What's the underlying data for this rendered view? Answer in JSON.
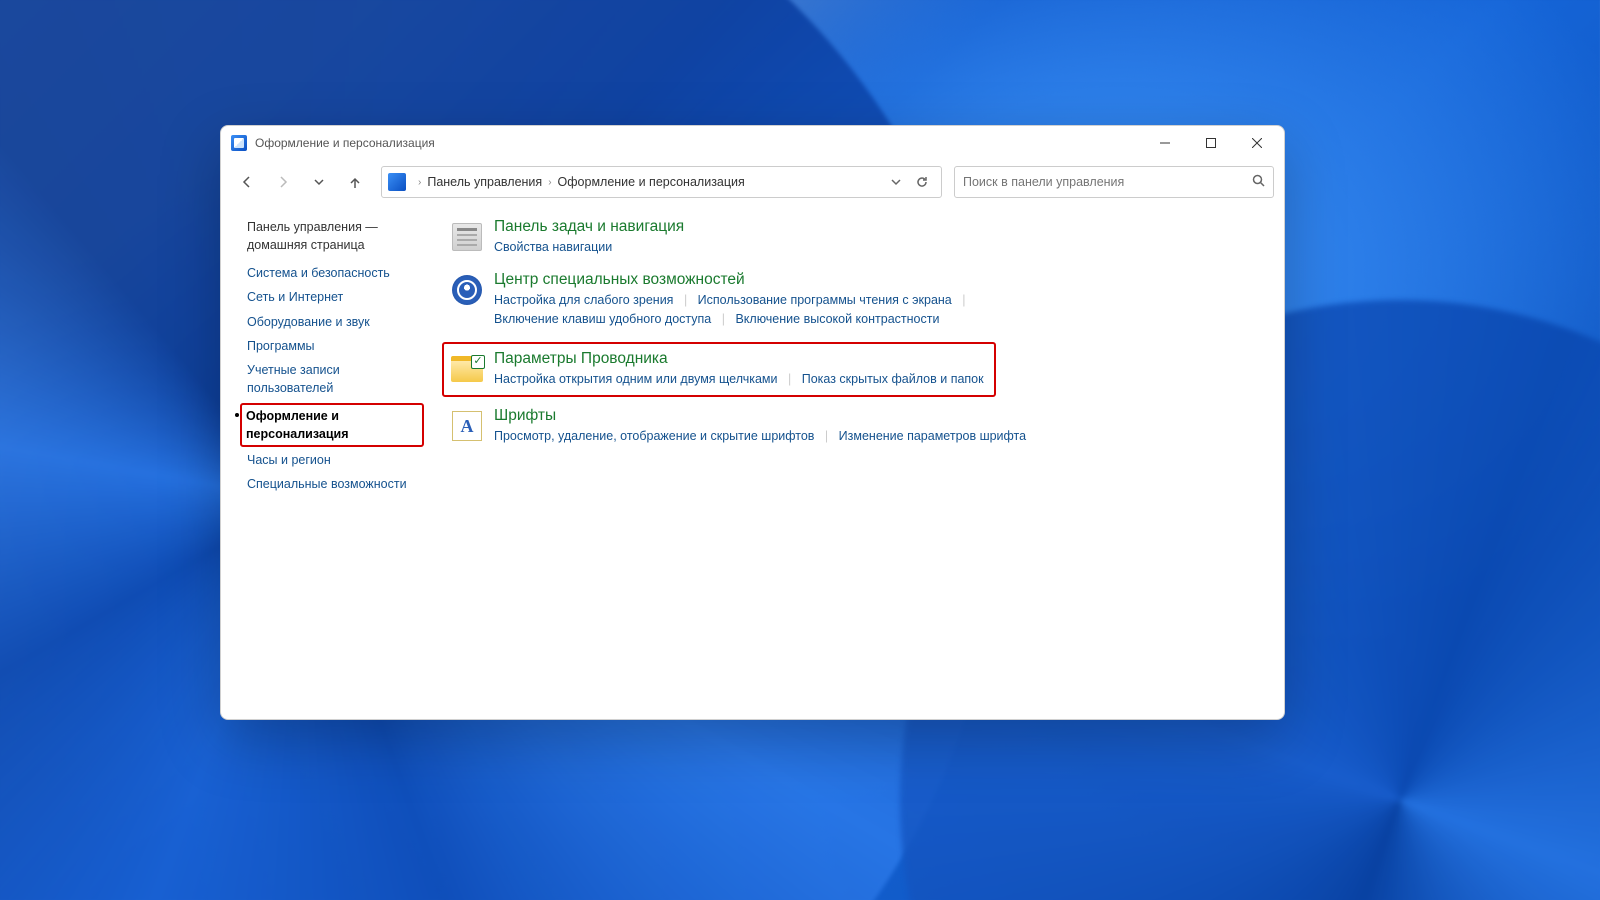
{
  "window": {
    "title": "Оформление и персонализация"
  },
  "breadcrumb": {
    "root": "Панель управления",
    "current": "Оформление и персонализация"
  },
  "search": {
    "placeholder": "Поиск в панели управления"
  },
  "sidebar": {
    "home_line1": "Панель управления —",
    "home_line2": "домашняя страница",
    "items": [
      "Система и безопасность",
      "Сеть и Интернет",
      "Оборудование и звук",
      "Программы",
      "Учетные записи пользователей",
      "Оформление и персонализация",
      "Часы и регион",
      "Специальные возможности"
    ]
  },
  "categories": {
    "taskbar": {
      "title": "Панель задач и навигация",
      "links": [
        "Свойства навигации"
      ]
    },
    "access": {
      "title": "Центр специальных возможностей",
      "links": [
        "Настройка для слабого зрения",
        "Использование программы чтения с экрана",
        "Включение клавиш удобного доступа",
        "Включение высокой контрастности"
      ]
    },
    "explorer": {
      "title": "Параметры Проводника",
      "links": [
        "Настройка открытия одним или двумя щелчками",
        "Показ скрытых файлов и папок"
      ]
    },
    "fonts": {
      "title": "Шрифты",
      "links": [
        "Просмотр, удаление, отображение и скрытие шрифтов",
        "Изменение параметров шрифта"
      ]
    }
  }
}
